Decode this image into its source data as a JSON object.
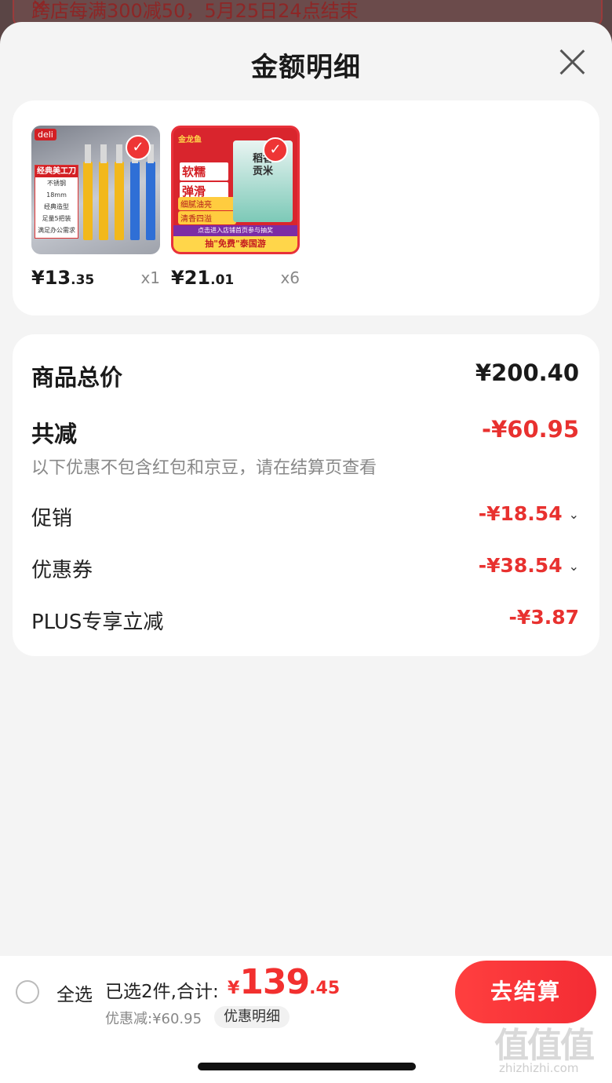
{
  "banner": {
    "text": "跨店每满300减50，5月25日24点结束",
    "close_icon": "close-icon"
  },
  "sheet": {
    "title": "金额明细",
    "close_icon": "close-icon"
  },
  "products": [
    {
      "name_icon": "utility-knife-product-image",
      "brand": "deli",
      "image_texts": [
        "经典美工刀",
        "不锈钢",
        "18mm",
        "经典造型",
        "足量5把装",
        "满足办公需求"
      ],
      "price_int": "¥13",
      "price_dec": ".35",
      "qty": "x1",
      "selected": true
    },
    {
      "name_icon": "rice-product-image",
      "brand": "金龙鱼",
      "image_texts": [
        "软糯",
        "弹滑",
        "细腻油亮",
        "清香四溢",
        "稻香贡米",
        "点击进入店铺首页参与抽奖",
        "抽\"免费\"泰国游"
      ],
      "price_int": "¥21",
      "price_dec": ".01",
      "qty": "x6",
      "selected": true
    }
  ],
  "summary": {
    "total_label": "商品总价",
    "total_value": "¥200.40",
    "discount_label": "共减",
    "discount_value": "-¥60.95",
    "note": "以下优惠不包含红包和京豆，请在结算页查看",
    "items": [
      {
        "label": "促销",
        "value": "-¥18.54",
        "expandable": true
      },
      {
        "label": "优惠券",
        "value": "-¥38.54",
        "expandable": true
      },
      {
        "label": "PLUS专享立减",
        "value": "-¥3.87",
        "expandable": false
      }
    ]
  },
  "footer": {
    "select_all": "全选",
    "selected_text": "已选2件,合计:",
    "total_yen": "¥",
    "total_int": "139",
    "total_dec": ".45",
    "saved_text": "优惠减:¥60.95",
    "detail_label": "优惠明细",
    "checkout_label": "去结算"
  },
  "watermark": {
    "main": "值值值",
    "sub": "zhizhizhi.com"
  },
  "colors": {
    "accent": "#e8312f",
    "checkout": "#f32c34",
    "background": "#f4f4f4"
  }
}
